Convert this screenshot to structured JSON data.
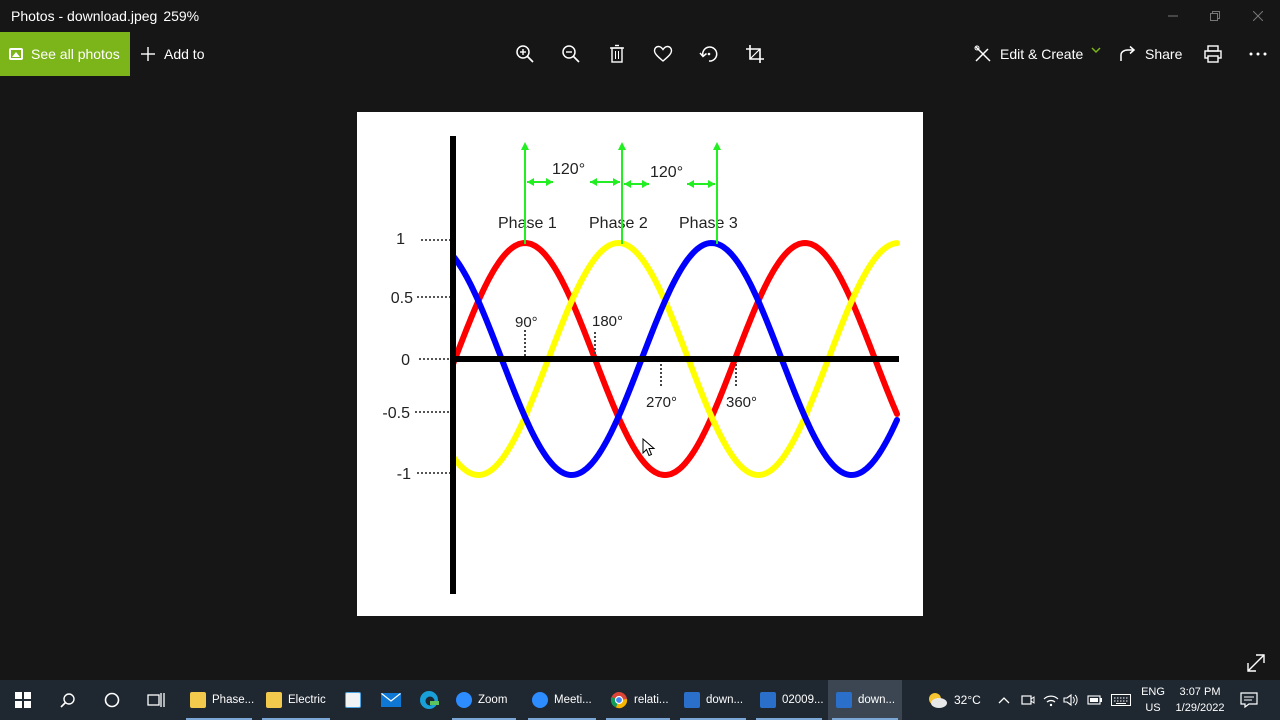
{
  "window": {
    "title": "Photos - download.jpeg",
    "zoom": "259%"
  },
  "toolbar": {
    "see_all_label": "See all photos",
    "add_to_label": "Add to",
    "edit_create_label": "Edit & Create",
    "share_label": "Share"
  },
  "figure": {
    "phase_labels": [
      "Phase 1",
      "Phase 2",
      "Phase 3"
    ],
    "spacing_labels": [
      "120°",
      "120°"
    ],
    "y_ticks": [
      "1",
      "0.5",
      "0",
      "-0.5",
      "-1"
    ],
    "angle_labels": [
      "90°",
      "180°",
      "270°",
      "360°"
    ],
    "colors": {
      "phase1": "#ff0000",
      "phase2": "#ffff00",
      "phase3": "#0000ff",
      "arrows": "#22ee22"
    }
  },
  "taskbar": {
    "apps": [
      "Phase...",
      "Electric",
      "Zoom",
      "Meeti...",
      "relati...",
      "down...",
      "02009...",
      "down..."
    ],
    "weather": "32°C",
    "lang_line1": "ENG",
    "lang_line2": "US",
    "time": "3:07 PM",
    "date": "1/29/2022"
  }
}
